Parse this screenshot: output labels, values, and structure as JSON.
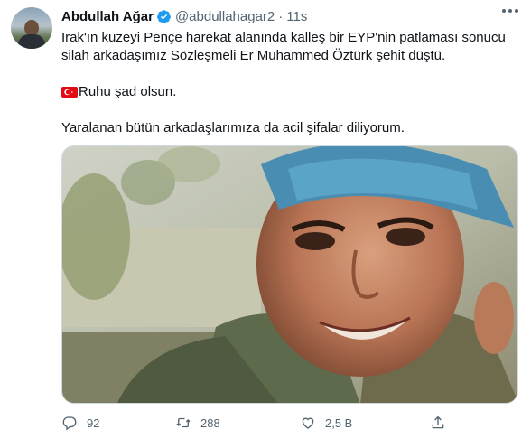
{
  "tweet": {
    "author_name": "Abdullah Ağar",
    "handle": "@abdullahagar2",
    "separator": "·",
    "time": "11s",
    "line1": "Irak'ın kuzeyi Pençe harekat alanında kalleş bir EYP'nin patlaması sonucu",
    "line2": "silah arkadaşımız Sözleşmeli Er Muhammed Öztürk şehit düştü.",
    "line3": "Ruhu şad olsun.",
    "line4": "Yaralanan bütün arkadaşlarımıza da acil şifalar diliyorum.",
    "flag_icon": "turkey-flag-icon"
  },
  "actions": {
    "replies": "92",
    "retweets": "288",
    "likes": "2,5 B"
  },
  "colors": {
    "verified": "#1d9bf0",
    "flag_red": "#e30a17",
    "muted": "#536471"
  }
}
